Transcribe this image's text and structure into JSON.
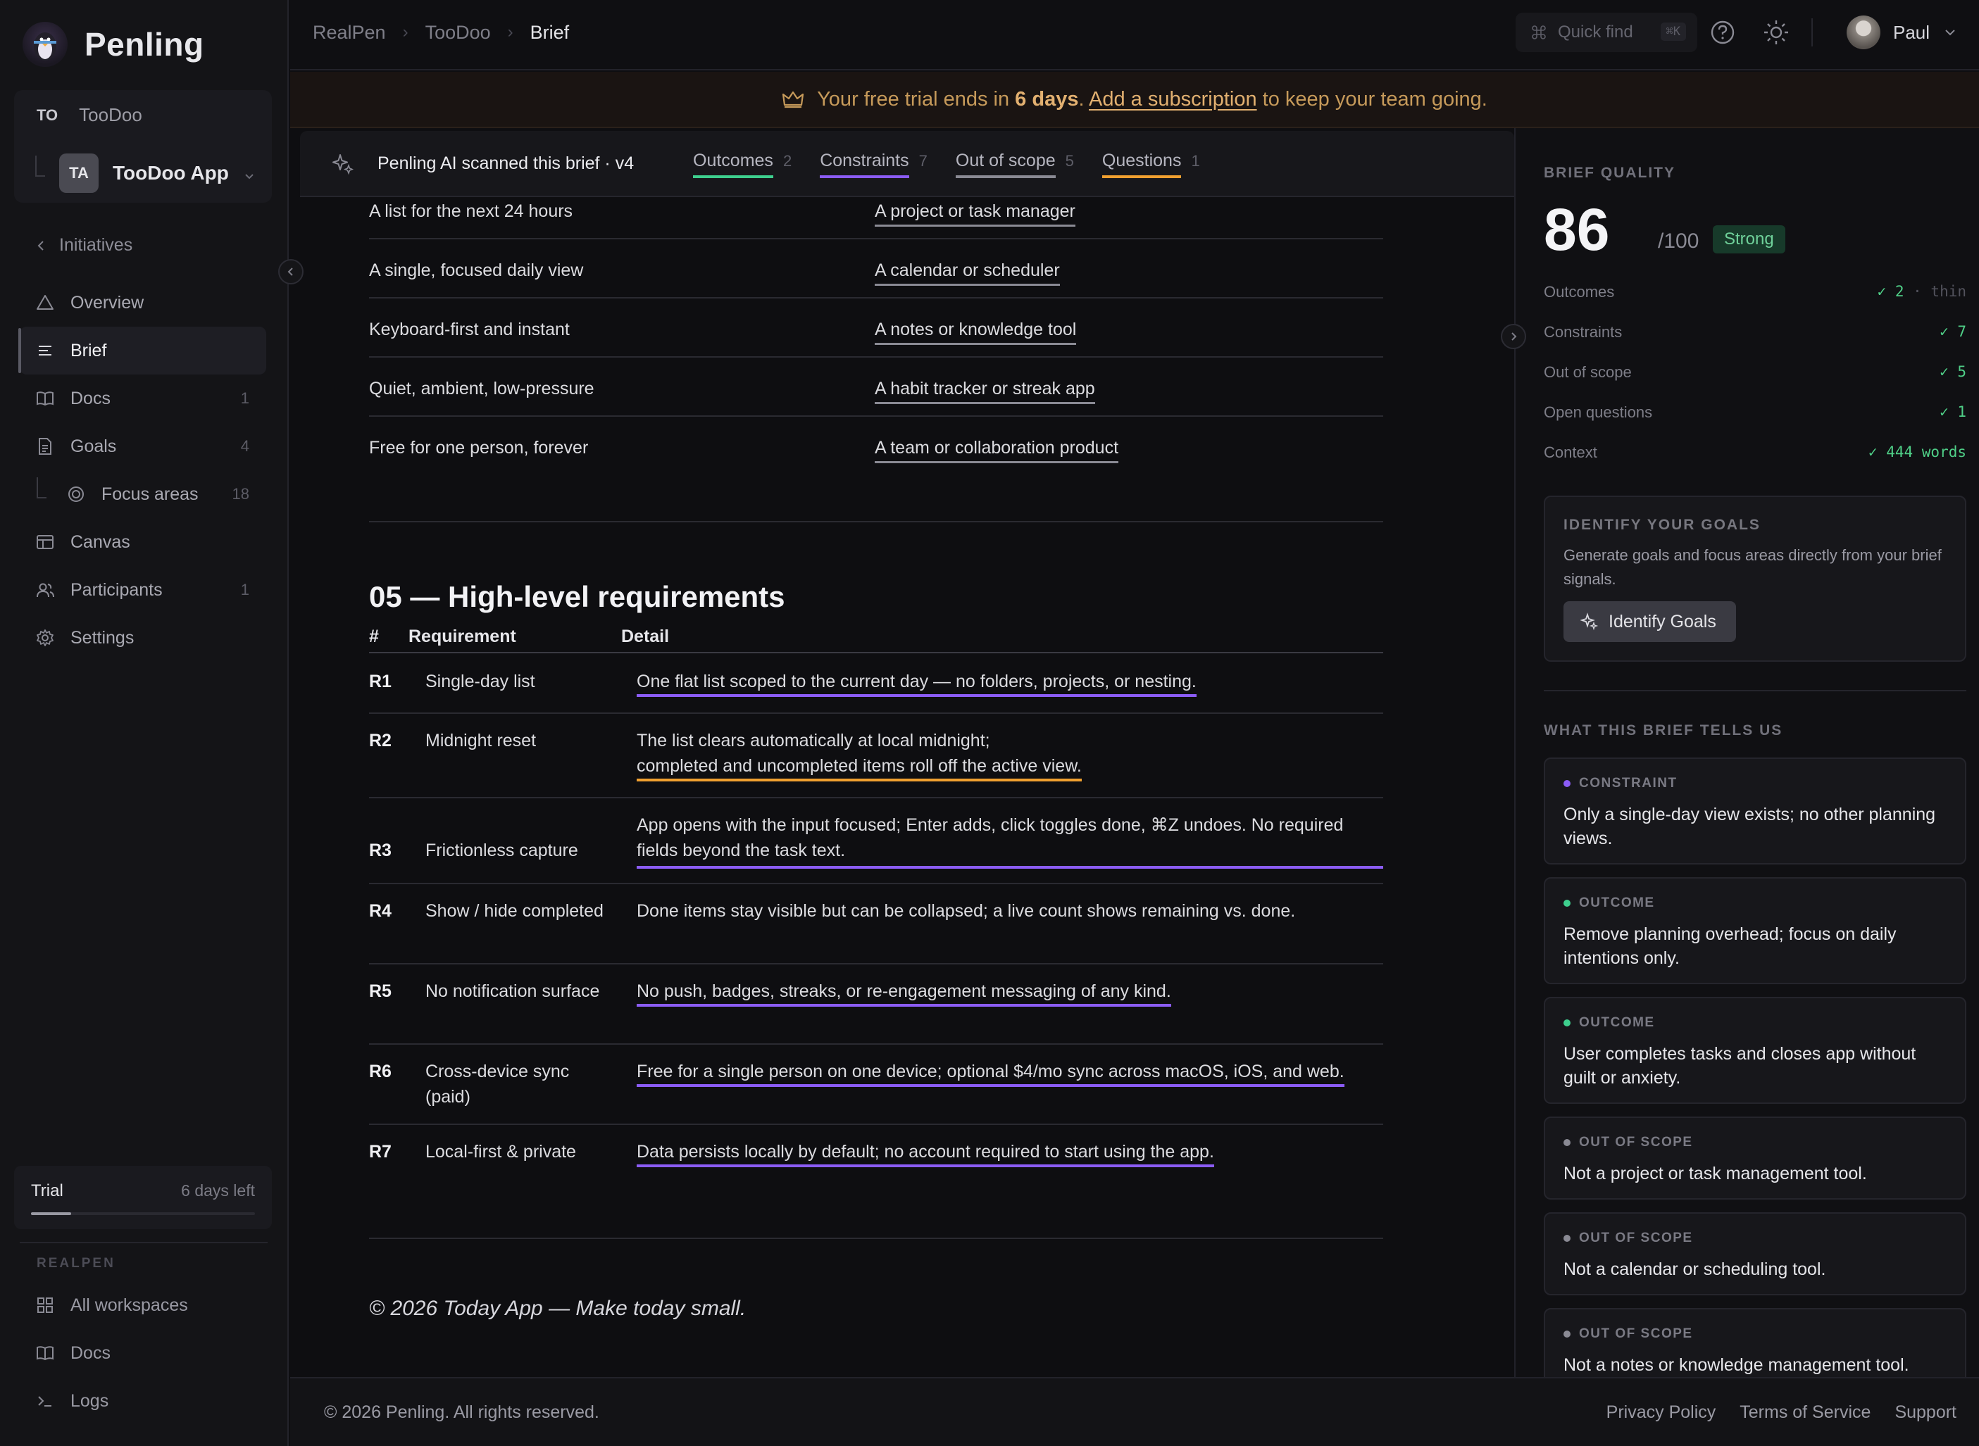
{
  "app": {
    "name": "Penling"
  },
  "workspace": {
    "abbr": "TO",
    "name": "TooDoo",
    "app_abbr": "TA",
    "app_name": "TooDoo App"
  },
  "sidebar": {
    "back_label": "Initiatives",
    "items": [
      {
        "label": "Overview",
        "icon": "triangle-icon",
        "count": ""
      },
      {
        "label": "Brief",
        "icon": "lines-icon",
        "count": "",
        "active": true
      },
      {
        "label": "Docs",
        "icon": "book-icon",
        "count": "1"
      },
      {
        "label": "Goals",
        "icon": "document-icon",
        "count": "4"
      },
      {
        "label": "Focus areas",
        "icon": "target-icon",
        "count": "18",
        "sub": true
      },
      {
        "label": "Canvas",
        "icon": "canvas-icon",
        "count": ""
      },
      {
        "label": "Participants",
        "icon": "people-icon",
        "count": "1"
      },
      {
        "label": "Settings",
        "icon": "gear-icon",
        "count": ""
      }
    ],
    "trial": {
      "label": "Trial",
      "days_left": "6 days left",
      "progress": 0.18
    },
    "section_label": "REALPEN",
    "footer_items": [
      {
        "label": "All workspaces",
        "icon": "grid-icon"
      },
      {
        "label": "Docs",
        "icon": "book-icon"
      },
      {
        "label": "Logs",
        "icon": "terminal-icon"
      }
    ]
  },
  "topbar": {
    "breadcrumbs": [
      "RealPen",
      "TooDoo",
      "Brief"
    ],
    "quick_find": "Quick find",
    "quick_find_kbd": "⌘K",
    "user_name": "Paul"
  },
  "banner": {
    "prefix": "Your free trial ends in",
    "days": "6 days",
    "period": ".",
    "link": "Add a subscription",
    "suffix": "to keep your team going."
  },
  "scan": {
    "title": "Penling AI scanned this brief · v4",
    "tabs": [
      {
        "label": "Outcomes",
        "count": "2",
        "color": "#3ecf8e"
      },
      {
        "label": "Constraints",
        "count": "7",
        "color": "#8b5cf6"
      },
      {
        "label": "Out of scope",
        "count": "5",
        "color": "#8a8a94"
      },
      {
        "label": "Questions",
        "count": "1",
        "color": "#f0a030"
      }
    ]
  },
  "scope_rows": [
    {
      "is": "A list for the next 24 hours",
      "is_not": "A project or task manager"
    },
    {
      "is": "A single, focused daily view",
      "is_not": "A calendar or scheduler"
    },
    {
      "is": "Keyboard-first and instant",
      "is_not": "A notes or knowledge tool"
    },
    {
      "is": "Quiet, ambient, low-pressure",
      "is_not": "A habit tracker or streak app"
    },
    {
      "is": "Free for one person, forever",
      "is_not": "A team or collaboration product"
    }
  ],
  "requirements": {
    "title": "05 — High-level requirements",
    "headers": {
      "num": "#",
      "requirement": "Requirement",
      "detail": "Detail"
    },
    "rows": [
      {
        "id": "R1",
        "name": "Single-day list",
        "detail": "One flat list scoped to the current day — no folders, projects, or nesting.",
        "tag": "constraint"
      },
      {
        "id": "R2",
        "name": "Midnight reset",
        "detail_lines": [
          "The list clears automatically at local midnight;",
          "completed and uncompleted items roll off the active view."
        ],
        "tag": "question"
      },
      {
        "id": "R3",
        "name": "Frictionless capture",
        "detail_lines": [
          "App opens with the input focused; Enter adds, click toggles done, ⌘Z undoes. No required",
          "fields beyond the task text."
        ],
        "tag": "constraint"
      },
      {
        "id": "R4",
        "name": "Show / hide completed",
        "detail": "Done items stay visible but can be collapsed; a live count shows remaining vs. done.",
        "tag": "none"
      },
      {
        "id": "R5",
        "name": "No notification surface",
        "detail": "No push, badges, streaks, or re-engagement messaging of any kind.",
        "tag": "constraint"
      },
      {
        "id": "R6",
        "name": "Cross-device sync (paid)",
        "detail": "Free for a single person on one device; optional $4/mo sync across macOS, iOS, and web.",
        "tag": "constraint"
      },
      {
        "id": "R7",
        "name": "Local-first & private",
        "detail": "Data persists locally by default; no account required to start using the app.",
        "tag": "constraint"
      }
    ]
  },
  "page_footer_note": "© 2026 Today App — Make today small.",
  "quality": {
    "label": "BRIEF QUALITY",
    "score": "86",
    "max": "/100",
    "badge": "Strong",
    "metrics": [
      {
        "label": "Outcomes",
        "value": "✓ 2",
        "extra": "· thin"
      },
      {
        "label": "Constraints",
        "value": "✓ 7",
        "extra": ""
      },
      {
        "label": "Out of scope",
        "value": "✓ 5",
        "extra": ""
      },
      {
        "label": "Open questions",
        "value": "✓ 1",
        "extra": ""
      },
      {
        "label": "Context",
        "value": "✓ 444 words",
        "extra": ""
      }
    ]
  },
  "identify": {
    "title": "IDENTIFY YOUR GOALS",
    "description": "Generate goals and focus areas directly from your brief signals.",
    "button": "Identify Goals"
  },
  "signals": {
    "title": "WHAT THIS BRIEF TELLS US",
    "items": [
      {
        "type": "CONSTRAINT",
        "color": "#8b5cf6",
        "text": "Only a single-day view exists; no other planning views."
      },
      {
        "type": "OUTCOME",
        "color": "#3ecf8e",
        "text": "Remove planning overhead; focus on daily intentions only."
      },
      {
        "type": "OUTCOME",
        "color": "#3ecf8e",
        "text": "User completes tasks and closes app without guilt or anxiety."
      },
      {
        "type": "OUT OF SCOPE",
        "color": "#8a8a94",
        "text": "Not a project or task management tool."
      },
      {
        "type": "OUT OF SCOPE",
        "color": "#8a8a94",
        "text": "Not a calendar or scheduling tool."
      },
      {
        "type": "OUT OF SCOPE",
        "color": "#8a8a94",
        "text": "Not a notes or knowledge management tool."
      }
    ]
  },
  "footer": {
    "copyright": "© 2026 Penling. All rights reserved.",
    "links": [
      "Privacy Policy",
      "Terms of Service",
      "Support"
    ]
  },
  "colors": {
    "constraint": "#8b5cf6",
    "outcome": "#3ecf8e",
    "question": "#f0a030",
    "out_of_scope": "#8a8a94"
  }
}
